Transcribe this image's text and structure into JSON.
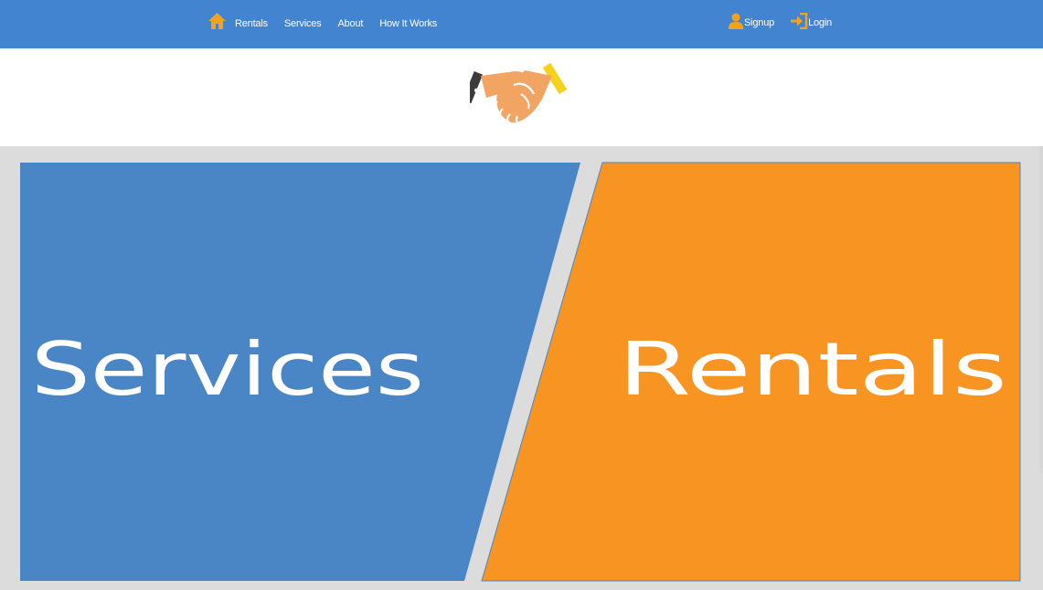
{
  "nav": {
    "home_icon": "home-icon",
    "links": [
      {
        "label": "Rentals"
      },
      {
        "label": "Services"
      },
      {
        "label": "About"
      },
      {
        "label": "How It Works"
      }
    ],
    "signup_label": "Signup",
    "login_label": "Login"
  },
  "logo": {
    "icon": "handshake-icon"
  },
  "hero": {
    "left_panel": {
      "label": "Services",
      "color": "#4a86c6"
    },
    "right_panel": {
      "label": "Rentals",
      "color": "#f79422"
    }
  },
  "colors": {
    "navbar": "#4384d0",
    "accent_orange": "#f6a11a",
    "background_gray": "#dcdcdc"
  }
}
